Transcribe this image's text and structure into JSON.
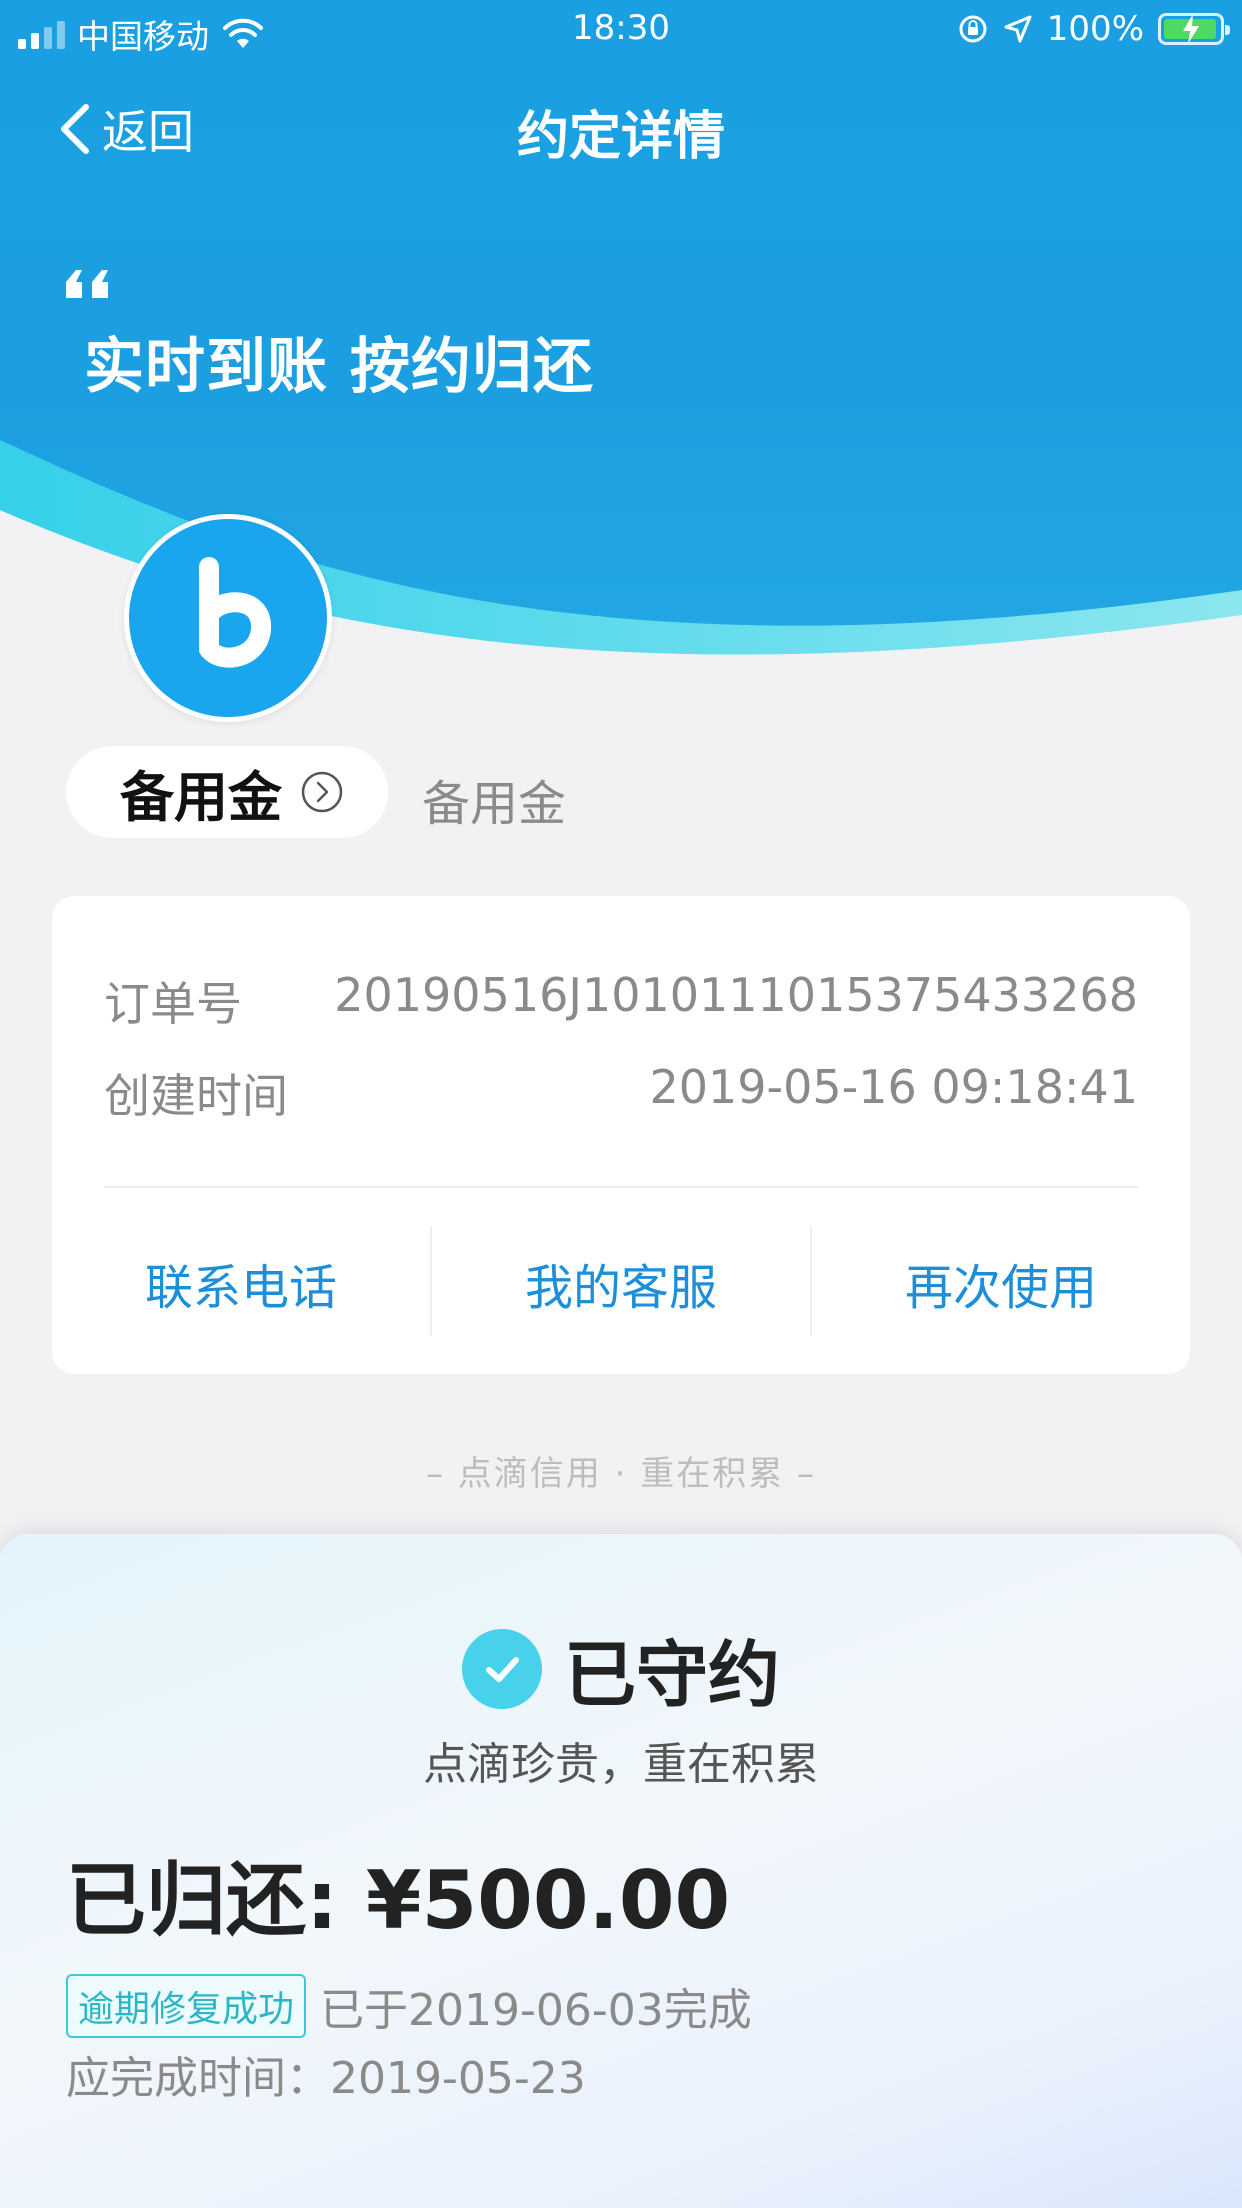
{
  "status_bar": {
    "carrier": "中国移动",
    "time": "18:30",
    "battery": "100%"
  },
  "nav": {
    "back_label": "返回",
    "title": "约定详情"
  },
  "hero": {
    "slogan": "实时到账 按约归还"
  },
  "product": {
    "name": "备用金",
    "subtitle": "备用金"
  },
  "order": {
    "order_no_label": "订单号",
    "order_no": "20190516J1010111015375433268",
    "created_label": "创建时间",
    "created_at": "2019-05-16 09:18:41"
  },
  "actions": {
    "contact": "联系电话",
    "service": "我的客服",
    "reuse": "再次使用"
  },
  "tagline": "– 点滴信用 · 重在积累 –",
  "result": {
    "status": "已守约",
    "sub": "点滴珍贵，重在积累",
    "returned": "已归还: ¥500.00",
    "badge": "逾期修复成功",
    "completed": "已于2019-06-03完成",
    "due": "应完成时间：2019-05-23"
  },
  "colors": {
    "header_blue": "#1aa0e2",
    "link_blue": "#1d8fd8",
    "check_cyan": "#47d1ea",
    "badge_cyan": "#2bb7c7"
  },
  "icons": {
    "back": "chevron-left-icon",
    "wifi": "wifi-icon",
    "lock": "orientation-lock-icon",
    "location": "location-arrow-icon",
    "battery": "battery-icon",
    "product_link": "chevron-right-circle-icon",
    "check": "check-icon",
    "quote": "quote-icon",
    "logo": "b-logo-icon"
  }
}
